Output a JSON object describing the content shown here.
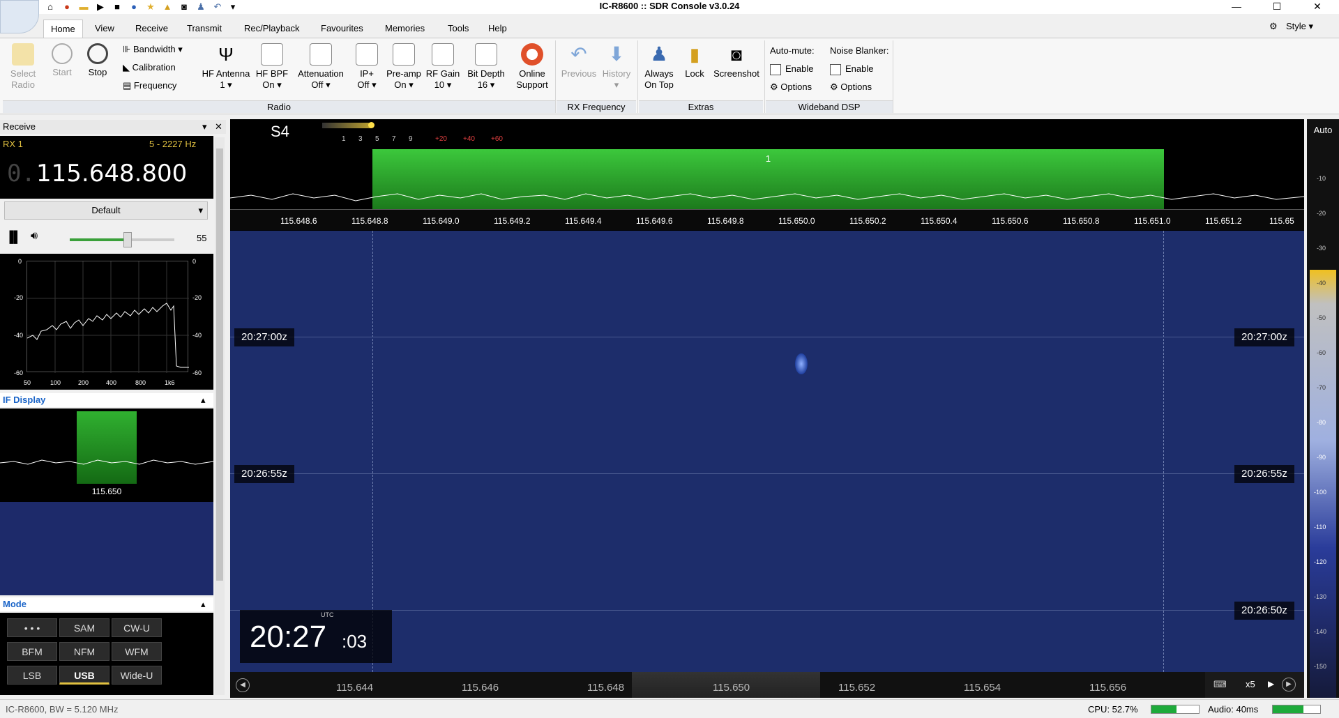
{
  "window": {
    "title": "IC-R8600 :: SDR Console v3.0.24",
    "min": "—",
    "max": "☐",
    "close": "✕"
  },
  "menu": {
    "tabs": [
      "Home",
      "View",
      "Receive",
      "Transmit",
      "Rec/Playback",
      "Favourites",
      "Memories",
      "Tools",
      "Help"
    ],
    "style": "Style"
  },
  "ribbon": {
    "select_radio": [
      "Select",
      "Radio"
    ],
    "start": "Start",
    "stop": "Stop",
    "bandwidth": "Bandwidth",
    "calibration": "Calibration",
    "frequency": "Frequency",
    "hf_antenna": [
      "HF Antenna",
      "1"
    ],
    "hf_bpf": [
      "HF BPF",
      "On"
    ],
    "attenuation": [
      "Attenuation",
      "Off"
    ],
    "ip_plus": [
      "IP+",
      "Off"
    ],
    "preamp": [
      "Pre-amp",
      "On"
    ],
    "rf_gain": [
      "RF Gain",
      "10"
    ],
    "bit_depth": [
      "Bit Depth",
      "16"
    ],
    "online_support": [
      "Online",
      "Support"
    ],
    "previous": "Previous",
    "history": "History",
    "always_on_top": [
      "Always",
      "On Top"
    ],
    "lock": "Lock",
    "screenshot": "Screenshot",
    "auto_mute": "Auto-mute:",
    "noise_blanker": "Noise Blanker:",
    "enable": "Enable",
    "options": "Options",
    "groups": {
      "radio": "Radio",
      "rx_frequency": "RX Frequency",
      "extras": "Extras",
      "wideband_dsp": "Wideband DSP"
    }
  },
  "left": {
    "receive": "Receive",
    "rx": "RX 1",
    "rx_range": "5 - 2227 Hz",
    "freq_dim": "0.",
    "freq": "115.648.800",
    "preset": "Default",
    "volume": "55",
    "volume_level": 0.55,
    "audio_scale_y": [
      "0",
      "-20",
      "-40",
      "-60"
    ],
    "audio_scale_x": [
      "50",
      "100",
      "200",
      "400",
      "800",
      "1k6"
    ],
    "if_display": "IF Display",
    "if_freq": "115.650",
    "mode": "Mode",
    "modes": [
      "• • •",
      "SAM",
      "CW-U",
      "BFM",
      "NFM",
      "WFM",
      "LSB",
      "USB",
      "Wide-U"
    ],
    "selected_mode": "USB"
  },
  "spectrum": {
    "smeter": "S4",
    "smeter_scale": [
      "1",
      "3",
      "5",
      "7",
      "9",
      "+20",
      "+40",
      "+60"
    ],
    "marker": "1",
    "freq_ticks": [
      "115.648.6",
      "115.648.8",
      "115.649.0",
      "115.649.2",
      "115.649.4",
      "115.649.6",
      "115.649.8",
      "115.650.0",
      "115.650.2",
      "115.650.4",
      "115.650.6",
      "115.650.8",
      "115.651.0",
      "115.651.2",
      "115.65"
    ],
    "auto": "Auto",
    "right_scale": [
      "-10",
      "-20",
      "-30",
      "-40",
      "-50",
      "-60",
      "-70",
      "-80",
      "-90",
      "-100",
      "-110",
      "-120",
      "-130",
      "-140",
      "-150"
    ]
  },
  "waterfall": {
    "timestamps": [
      "20:27:00z",
      "20:26:55z",
      "20:26:50z"
    ],
    "clock_label": "UTC",
    "clock_hm": "20:27",
    "clock_s": ":03",
    "bottom_ticks": [
      "115.644",
      "115.646",
      "115.648",
      "115.650",
      "115.652",
      "115.654",
      "115.656"
    ],
    "zoom": "x5"
  },
  "status": {
    "left": "IC-R8600, BW = 5.120 MHz",
    "cpu": "CPU: 52.7%",
    "cpu_level": 0.527,
    "audio": "Audio: 40ms",
    "audio_level": 0.65
  }
}
